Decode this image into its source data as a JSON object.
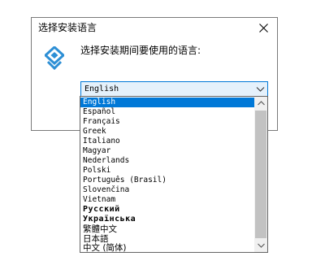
{
  "window": {
    "title": "选择安装语言"
  },
  "prompt": {
    "text": "选择安装期间要使用的语言:"
  },
  "combo": {
    "selected": "English"
  },
  "languages": [
    "English",
    "Español",
    "Français",
    "Greek",
    "Italiano",
    "Magyar",
    "Nederlands",
    "Polski",
    "Português (Brasil)",
    "Slovenčina",
    "Vietnam",
    "Русский",
    "Українська",
    "繁體中文",
    "日本語",
    "中文 (简体)"
  ],
  "selected_index": 0,
  "colors": {
    "selection": "#0078d7",
    "combo_bg": "#e5f1fb",
    "icon_blue": "#2d8fd5"
  },
  "icons": {
    "close": "close-icon",
    "app": "installer-logo-icon",
    "combo_arrow": "chevron-down-icon",
    "scroll_up": "chevron-up-icon",
    "scroll_down": "chevron-down-icon"
  }
}
